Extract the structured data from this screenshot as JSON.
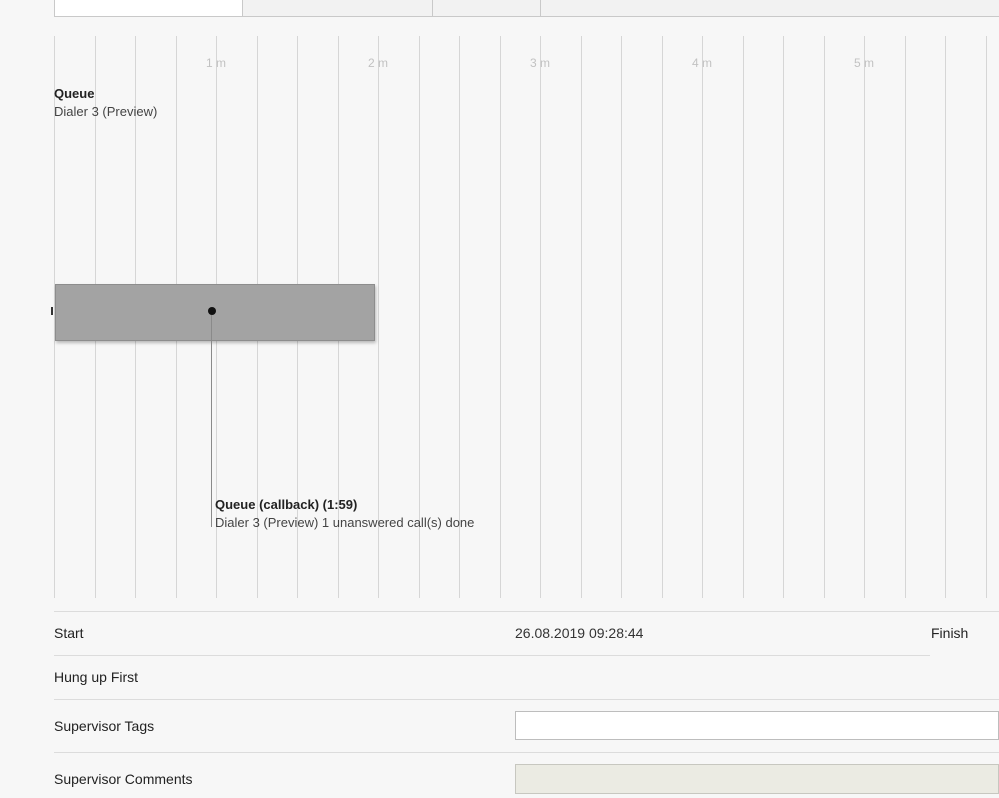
{
  "timeline": {
    "ticks": [
      "1 m",
      "2 m",
      "3 m",
      "4 m",
      "5 m"
    ],
    "lane": {
      "title": "Queue",
      "subtitle": "Dialer 3 (Preview)"
    },
    "event": {
      "title": "Queue (callback) (1:59)",
      "detail": "Dialer 3 (Preview) 1 unanswered call(s) done"
    }
  },
  "details": {
    "start_label": "Start",
    "start_value": "26.08.2019 09:28:44",
    "finish_label": "Finish",
    "hungup_label": "Hung up First",
    "tags_label": "Supervisor Tags",
    "tags_value": "",
    "comments_label": "Supervisor Comments",
    "comments_value": ""
  }
}
